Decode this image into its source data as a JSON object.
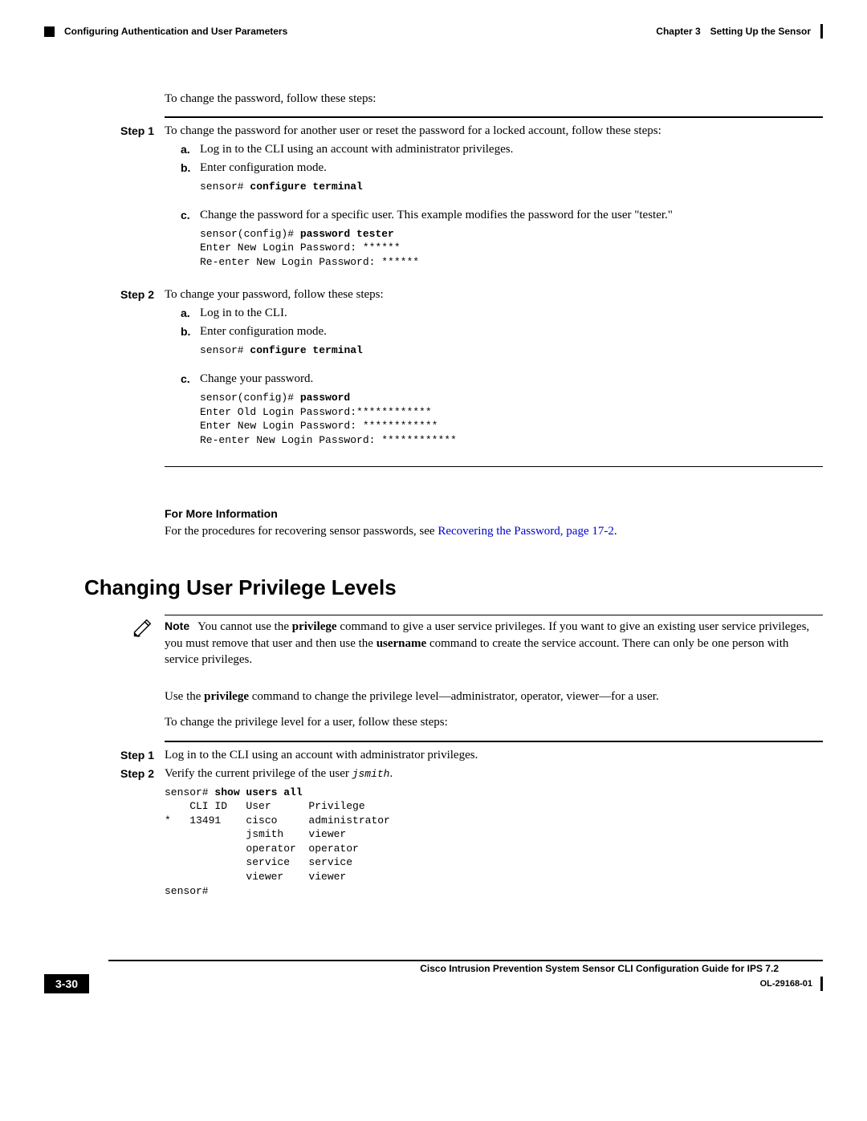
{
  "header": {
    "chapter_label": "Chapter 3",
    "chapter_title": "Setting Up the Sensor",
    "section_title": "Configuring Authentication and User Parameters"
  },
  "intro_text": "To change the password, follow these steps:",
  "step1": {
    "label": "Step 1",
    "text": "To change the password for another user or reset the password for a locked account, follow these steps:",
    "a": {
      "marker": "a.",
      "text": "Log in to the CLI using an account with administrator privileges."
    },
    "b": {
      "marker": "b.",
      "text": "Enter configuration mode.",
      "code_prefix": "sensor# ",
      "code_bold": "configure terminal"
    },
    "c": {
      "marker": "c.",
      "text": "Change the password for a specific user. This example modifies the password for the user \"tester.\"",
      "code_line1_prefix": "sensor(config)# ",
      "code_line1_bold": "password tester",
      "code_rest": "Enter New Login Password: ******\nRe-enter New Login Password: ******"
    }
  },
  "step2": {
    "label": "Step 2",
    "text": "To change your password, follow these steps:",
    "a": {
      "marker": "a.",
      "text": "Log in to the CLI."
    },
    "b": {
      "marker": "b.",
      "text": "Enter configuration mode.",
      "code_prefix": "sensor# ",
      "code_bold": "configure terminal"
    },
    "c": {
      "marker": "c.",
      "text": "Change your password.",
      "code_line1_prefix": "sensor(config)# ",
      "code_line1_bold": "password",
      "code_rest": "Enter Old Login Password:************\nEnter New Login Password: ************\nRe-enter New Login Password: ************"
    }
  },
  "more_info": {
    "heading": "For More Information",
    "text_before": "For the procedures for recovering sensor passwords, see ",
    "link_text": "Recovering the Password, page 17-2",
    "text_after": "."
  },
  "major_heading": "Changing User Privilege Levels",
  "note": {
    "label": "Note",
    "p1a": "You cannot use the ",
    "p1b": "privilege",
    "p1c": " command to give a user service privileges. If you want to give an existing user service privileges, you must remove that user and then use the ",
    "p1d": "username",
    "p1e": " command to create the service account. There can only be one person with service privileges."
  },
  "para_use": {
    "a": "Use the ",
    "b": "privilege",
    "c": " command to change the privilege level—administrator, operator, viewer—for a user."
  },
  "para_change": "To change the privilege level for a user, follow these steps:",
  "sec2_step1": {
    "label": "Step 1",
    "text": "Log in to the CLI using an account with administrator privileges."
  },
  "sec2_step2": {
    "label": "Step 2",
    "text_before": "Verify the current privilege of the user ",
    "code_inline": "jsmith",
    "text_after": ".",
    "code_line1_prefix": "sensor# ",
    "code_line1_bold": "show users all",
    "code_rest": "    CLI ID   User      Privilege\n*   13491    cisco     administrator\n             jsmith    viewer\n             operator  operator\n             service   service\n             viewer    viewer\nsensor#"
  },
  "footer": {
    "guide_title": "Cisco Intrusion Prevention System Sensor CLI Configuration Guide for IPS 7.2",
    "page_num": "3-30",
    "doc_id": "OL-29168-01"
  }
}
